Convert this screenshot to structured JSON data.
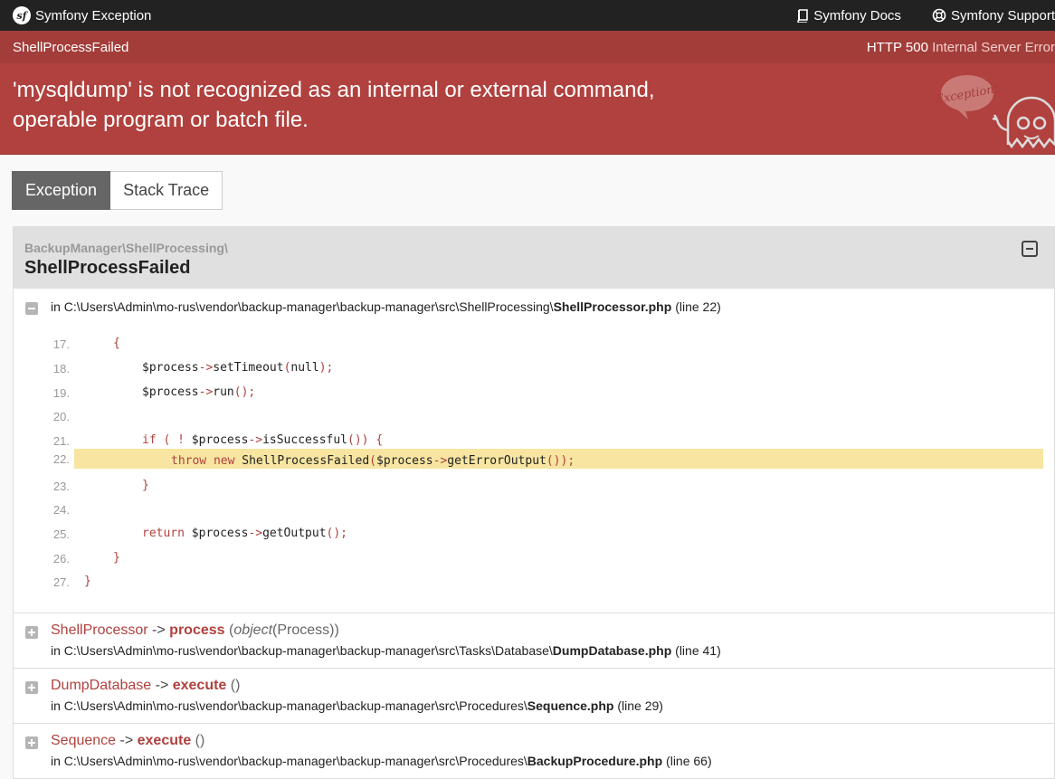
{
  "topbar": {
    "brand_logo": "sf",
    "brand": "Symfony Exception",
    "docs_label": "Symfony Docs",
    "support_label": "Symfony Support"
  },
  "status": {
    "exception_class": "ShellProcessFailed",
    "http_code": "HTTP 500",
    "http_text": "Internal Server Error"
  },
  "header": {
    "message_line1": "'mysqldump' is not recognized as an internal or external command,",
    "message_line2": "operable program or batch file.",
    "ghost_bubble": "Exception!"
  },
  "tabs": [
    {
      "label": "Exception",
      "active": true
    },
    {
      "label": "Stack Trace",
      "active": false
    }
  ],
  "panel": {
    "namespace": "BackupManager\\ShellProcessing\\",
    "class": "ShellProcessFailed",
    "location_prefix": "in C:\\Users\\Admin\\mo-rus\\vendor\\backup-manager\\backup-manager\\src\\ShellProcessing\\",
    "location_file": "ShellProcessor.php",
    "location_line": "(line 22)"
  },
  "code_lines": [
    {
      "num": "17.",
      "indent": 1,
      "html": "<span class=\"pn\">{</span>"
    },
    {
      "num": "18.",
      "indent": 2,
      "html": "$process<span class=\"pn\">-&gt;</span>setTimeout<span class=\"pn\">(</span>null<span class=\"pn\">);</span>"
    },
    {
      "num": "19.",
      "indent": 2,
      "html": "$process<span class=\"pn\">-&gt;</span>run<span class=\"pn\">();</span>"
    },
    {
      "num": "20.",
      "indent": 0,
      "html": ""
    },
    {
      "num": "21.",
      "indent": 2,
      "html": "<span class=\"kw\">if</span> <span class=\"pn\">(</span> <span class=\"pn\">!</span> $process<span class=\"pn\">-&gt;</span>isSuccessful<span class=\"pn\">())</span> <span class=\"pn\">{</span>"
    },
    {
      "num": "22.",
      "indent": 3,
      "html": "<span class=\"kw\">throw</span> <span class=\"kw\">new</span> ShellProcessFailed<span class=\"pn\">(</span>$process<span class=\"pn\">-&gt;</span>getErrorOutput<span class=\"pn\">());</span>",
      "highlight": true
    },
    {
      "num": "23.",
      "indent": 2,
      "html": "<span class=\"pn\">}</span>"
    },
    {
      "num": "24.",
      "indent": 0,
      "html": ""
    },
    {
      "num": "25.",
      "indent": 2,
      "html": "<span class=\"kw\">return</span> $process<span class=\"pn\">-&gt;</span>getOutput<span class=\"pn\">();</span>"
    },
    {
      "num": "26.",
      "indent": 1,
      "html": "<span class=\"pn\">}</span>"
    },
    {
      "num": "27.",
      "indent": 0,
      "html": "<span class=\"pn\">}</span>"
    }
  ],
  "trace": [
    {
      "class": "ShellProcessor",
      "method": "process",
      "args_type": "object",
      "args_value": "(Process)",
      "location_prefix": "in C:\\Users\\Admin\\mo-rus\\vendor\\backup-manager\\backup-manager\\src\\Tasks\\Database\\",
      "file": "DumpDatabase.php",
      "line": "(line 41)"
    },
    {
      "class": "DumpDatabase",
      "method": "execute",
      "args_type": "",
      "args_value": "",
      "location_prefix": "in C:\\Users\\Admin\\mo-rus\\vendor\\backup-manager\\backup-manager\\src\\Procedures\\",
      "file": "Sequence.php",
      "line": "(line 29)"
    },
    {
      "class": "Sequence",
      "method": "execute",
      "args_type": "",
      "args_value": "",
      "location_prefix": "in C:\\Users\\Admin\\mo-rus\\vendor\\backup-manager\\backup-manager\\src\\Procedures\\",
      "file": "BackupProcedure.php",
      "line": "(line 66)"
    }
  ],
  "colors": {
    "topbar": "#222222",
    "status_bar": "#a33d3a",
    "header": "#b0413e",
    "highlight": "#f7e5a1",
    "accent": "#b0413e"
  }
}
